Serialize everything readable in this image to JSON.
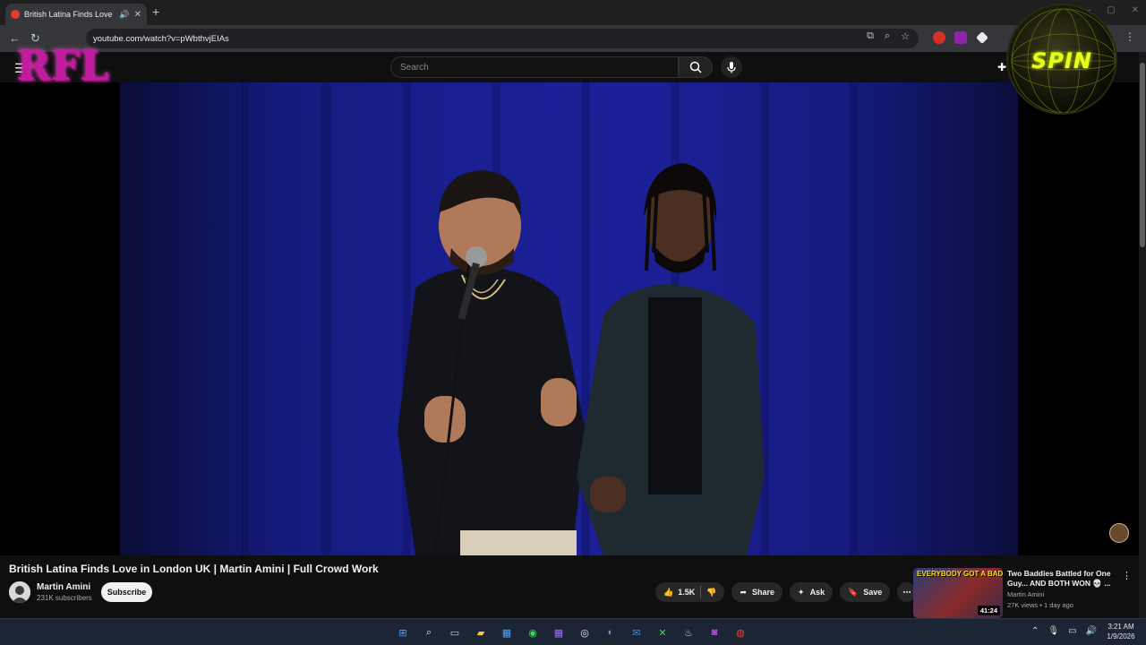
{
  "browser": {
    "tab_title": "British Latina Finds Love in L",
    "url": "youtube.com/watch?v=pWbthvjEIAs"
  },
  "youtube": {
    "search_placeholder": "Search"
  },
  "overlays": {
    "left_logo_text": "RFL",
    "right_logo_text": "SPIN"
  },
  "video": {
    "title": "British Latina Finds Love in London UK | Martin Amini | Full Crowd Work",
    "channel_name": "Martin Amini",
    "subscribers": "231K subscribers",
    "subscribe_label": "Subscribe",
    "likes": "1.5K",
    "share_label": "Share",
    "ask_label": "Ask",
    "save_label": "Save"
  },
  "recommendation": {
    "thumb_text": "EVERYBODY GOT A BADDIE",
    "duration": "41:24",
    "title": "Two Baddies Battled for One Guy... AND BOTH WON 💀 ...",
    "channel": "Martin Amini",
    "meta": "27K views • 1 day ago"
  },
  "taskbar": {
    "time": "3:21 AM",
    "date": "1/9/2026"
  }
}
